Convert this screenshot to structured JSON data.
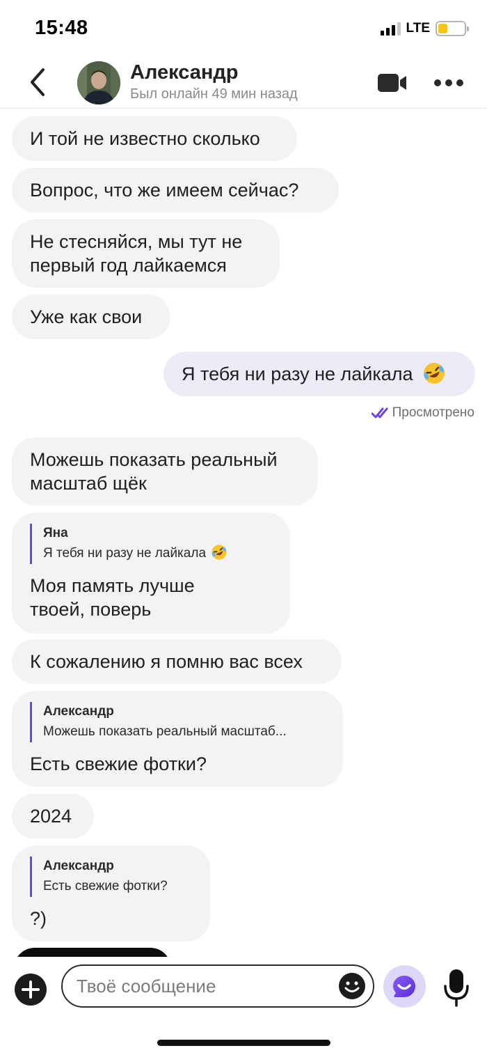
{
  "status_bar": {
    "time": "15:48",
    "network": "LTE",
    "battery_level": 0.35,
    "battery_color": "#f5c518"
  },
  "header": {
    "back_icon": "chevron-left-icon",
    "contact_name": "Александр",
    "contact_status": "Был онлайн 49 мин назад",
    "video_icon": "video-camera-icon",
    "more_icon": "more-horizontal-icon"
  },
  "messages": [
    {
      "direction": "in",
      "text": "И той не известно сколько"
    },
    {
      "direction": "in",
      "text": "Вопрос, что же имеем сейчас?"
    },
    {
      "direction": "in",
      "text": "Не стесняйся, мы тут не\nпервый год лайкаемся"
    },
    {
      "direction": "in",
      "text": "Уже как свои"
    },
    {
      "direction": "out",
      "text": "Я тебя ни разу не лайкала",
      "emoji": "rolling-on-floor-laughing-emoji"
    },
    {
      "direction": "in",
      "text": "Можешь показать реальный\nмасштаб щёк"
    },
    {
      "direction": "in",
      "reply_author": "Яна",
      "reply_text": "Я тебя ни разу не лайкала",
      "reply_emoji": "rolling-on-floor-laughing-emoji",
      "text": "Моя память лучше\nтвоей, поверь"
    },
    {
      "direction": "in",
      "text": "К сожалению я помню вас всех"
    },
    {
      "direction": "in",
      "reply_author": "Александр",
      "reply_text": "Можешь показать реальный масштаб...",
      "text": "Есть свежие фотки?"
    },
    {
      "direction": "in",
      "text": "2024"
    },
    {
      "direction": "in",
      "reply_author": "Александр",
      "reply_text": "Есть свежие фотки?",
      "text": "?)"
    }
  ],
  "seen_label": "Просмотрено",
  "seen_icon": "double-check-icon",
  "accent_color": "#6c46e0",
  "input_bar": {
    "placeholder": "Твоё сообщение",
    "plus_icon": "plus-circle-icon",
    "emoji_icon": "smiley-icon",
    "assistant_icon": "assistant-smile-icon",
    "mic_icon": "microphone-icon"
  }
}
